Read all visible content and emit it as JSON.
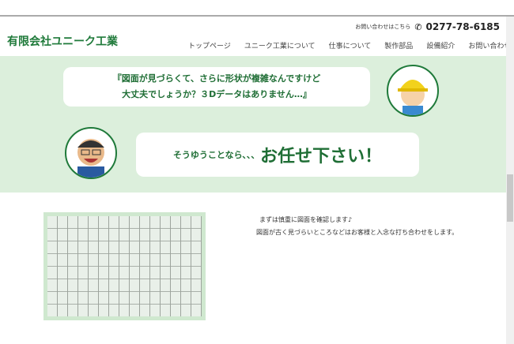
{
  "header": {
    "logo": "有限会社ユニーク工業",
    "contact_label": "お問い合わせはこちら",
    "phone": "0277-78-6185",
    "nav": [
      "トップページ",
      "ユニーク工業について",
      "仕事について",
      "製作部品",
      "設備紹介",
      "お問い合わせ"
    ]
  },
  "hero": {
    "customer_line1": "『図面が見づらくて、さらに形状が複雑なんですけど",
    "customer_line2": "大丈夫でしょうか？３Dデータはありません…』",
    "reply_small": "そうゆうことなら､､､",
    "reply_large": "お任せ下さい！"
  },
  "content": {
    "line1": "まずは慎重に図面を確認します♪",
    "line2": "図面が古く見づらいところなどはお客様と入念な打ち合わせをします。"
  },
  "colors": {
    "brand": "#1f7a3a",
    "band": "#dcefdc"
  }
}
